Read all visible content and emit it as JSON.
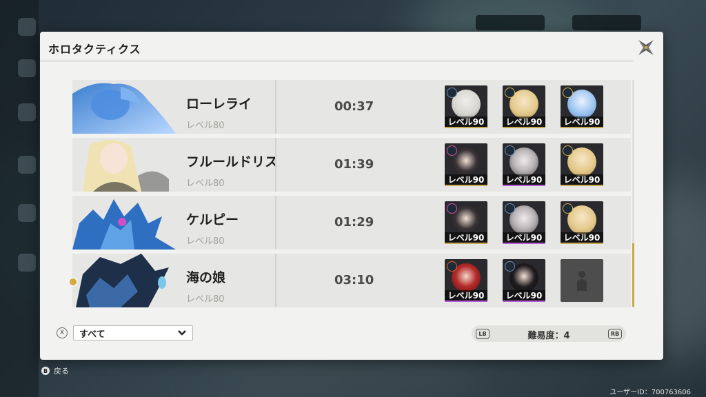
{
  "panel": {
    "title": "ホロタクティクス"
  },
  "colors": {
    "accent_gold": "#c8a951",
    "accent_purple": "#b65ad6"
  },
  "rows": [
    {
      "name": "ローレライ",
      "level": "レベル80",
      "time": "00:37",
      "team": [
        {
          "level": "レベル90",
          "element": "ice",
          "tier": "gold"
        },
        {
          "level": "レベル90",
          "element": "thunder",
          "tier": "gold"
        },
        {
          "level": "レベル90",
          "element": "thunder",
          "tier": "gold"
        }
      ]
    },
    {
      "name": "フルールドリス",
      "level": "レベル80",
      "time": "01:39",
      "team": [
        {
          "level": "レベル90",
          "element": "physical",
          "tier": "gold"
        },
        {
          "level": "レベル90",
          "element": "ice",
          "tier": "purple"
        },
        {
          "level": "レベル90",
          "element": "thunder",
          "tier": "gold"
        }
      ]
    },
    {
      "name": "ケルピー",
      "level": "レベル80",
      "time": "01:29",
      "team": [
        {
          "level": "レベル90",
          "element": "physical",
          "tier": "gold"
        },
        {
          "level": "レベル90",
          "element": "ice",
          "tier": "purple"
        },
        {
          "level": "レベル90",
          "element": "thunder",
          "tier": "gold"
        }
      ]
    },
    {
      "name": "海の娘",
      "level": "レベル80",
      "time": "03:10",
      "team": [
        {
          "level": "レベル90",
          "element": "flame",
          "tier": "purple"
        },
        {
          "level": "レベル90",
          "element": "ice",
          "tier": "purple"
        },
        {
          "empty": true
        }
      ]
    }
  ],
  "filter": {
    "button_glyph": "X",
    "selected": "すべて"
  },
  "difficulty": {
    "lb": "LB",
    "rb": "RB",
    "label": "難易度：4"
  },
  "footer": {
    "back_glyph": "B",
    "back_label": "戻る",
    "user_id": "ユーザーID：700763606"
  }
}
